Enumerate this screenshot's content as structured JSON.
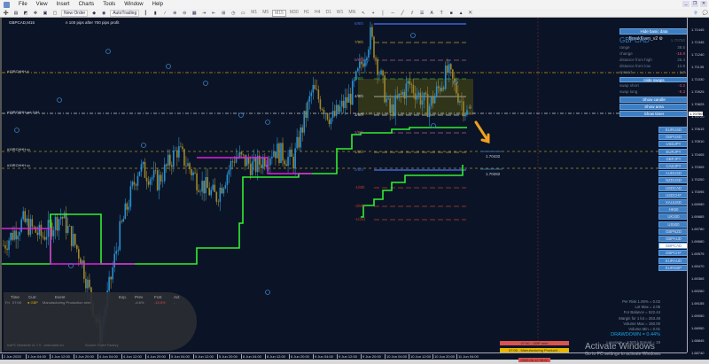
{
  "menu": [
    "File",
    "View",
    "Insert",
    "Charts",
    "Tools",
    "Window",
    "Help"
  ],
  "toolbar": {
    "new_order": "New Order",
    "autotrading": "AutoTrading",
    "timeframes": [
      "M1",
      "M5",
      "M15",
      "M30",
      "H1",
      "H4",
      "D1",
      "W1",
      "MN"
    ]
  },
  "chart": {
    "title": "GBPCAD,M15",
    "note": "n 100 pips after 700 pips profit",
    "ea_name": "BreakEven_v2",
    "levels": [
      {
        "label": "#15RCHHH d",
        "color": "#d58f1a"
      },
      {
        "label": "#15RCHHH wd 2:04",
        "color": "#c8c8d0"
      },
      {
        "label": "#15RCHHH rp",
        "color": "#b08a2a"
      },
      {
        "label": "#15RCHHH rp",
        "color": "#b08a2a"
      }
    ],
    "fib": [
      {
        "label": "8/8th",
        "color": "#3b64d8"
      },
      {
        "label": "7/8th",
        "color": "#b89a3a"
      },
      {
        "label": "6/8th",
        "color": "#b05a8a"
      },
      {
        "label": "5/8th",
        "color": "#3ea33e"
      },
      {
        "label": "4/8th",
        "color": "#c8c8c8"
      },
      {
        "label": "3/8th",
        "color": "#c8c8c8"
      },
      {
        "label": "2/8th",
        "color": "#b05a8a"
      },
      {
        "label": "1/8th",
        "color": "#b89a3a"
      },
      {
        "label": "0/8th",
        "color": "#3b64d8"
      },
      {
        "label": "-1/8th",
        "color": "#c0392b"
      },
      {
        "label": "-2/8th",
        "color": "#c0392b"
      },
      {
        "label": "-1/3rd",
        "color": "#c0392b"
      }
    ],
    "target1": "1.70432",
    "target2": "1.70282",
    "pip_label": "0.32"
  },
  "panel": {
    "hide_basic": "Hide basic data",
    "symbol": "GBPCAD",
    "price": "1.70750",
    "rows": [
      {
        "label": "range",
        "value": "38.5",
        "color": "#6b7f93"
      },
      {
        "label": "change",
        "value": "-15.9",
        "color": "#e05070"
      },
      {
        "label": "distance from high",
        "value": "25.4",
        "color": "#6b7f93"
      },
      {
        "label": "distance from low",
        "value": "12.8",
        "color": "#6b7f93"
      },
      {
        "label": "spread",
        "value": "1.9",
        "color": "#6b7f93"
      }
    ],
    "hide_swaps": "Hide swaps",
    "swaps": [
      {
        "label": "swap short",
        "value": "-3.2"
      },
      {
        "label": "swap long",
        "value": "-9.3"
      }
    ],
    "show_candle": "Show candle",
    "show_area": "Show area",
    "show_timer": "Show timer"
  },
  "symbols": [
    "EURUSD",
    "GBPUSD",
    "USDJPY",
    "EURJPY",
    "GBPJPY",
    "CADJPY",
    "AUDUSD",
    "NZDUSD",
    "USDCAD",
    "USDCHF",
    "XAUUSD",
    "HK50",
    "UK100",
    "US500",
    "GBPNZD",
    "GBPAUD",
    "GBPCAD",
    "GBPCHF",
    "EURAUD",
    "EURGBP"
  ],
  "selected_symbol": "GBPCAD",
  "stats": [
    "Per Risk 1.00% = 0.02",
    "Lot Max = 2.05",
    "For Balance = 522.44",
    "Margin for 1 lot = 253.48",
    "Volume Max = 150.00",
    "Volume Min = 0.01"
  ],
  "drawdown": "DRAWDOWN = 0.44%",
  "leverage": "Leverage = 1:500 | Spread = 19",
  "news": {
    "headers": [
      "Time",
      "Curr.",
      "Event",
      "Exp.",
      "Prev",
      "Fcst",
      "Act"
    ],
    "row": [
      "Fri",
      "07:00",
      "GBP",
      "Manufacturing Production m/m",
      "",
      "-4.6%",
      "-15.5%",
      "-"
    ],
    "footer_left": "IsaFX NewsInfo v1.7.0  -  www.isafx.eu",
    "footer_right": "Source: Forex Factory"
  },
  "events": {
    "e1": "07:00 - GBP m/m",
    "e2": "07:00 - Manufacturing Producti...",
    "date": "2020.06.12 08:00"
  },
  "price_axis": [
    "1.71445",
    "1.71345",
    "1.71240",
    "1.71135",
    "1.71030",
    "1.70925",
    "1.70825",
    "1.70720",
    "1.70615",
    "1.70510",
    "1.70405",
    "1.70305",
    "1.70200",
    "1.70095",
    "1.69990",
    "1.69885",
    "1.69780",
    "1.69680",
    "1.69575",
    "1.69470",
    "1.69365",
    "1.69260",
    "1.69155",
    "1.69050",
    "1.68950",
    "1.68845",
    "1.68740"
  ],
  "time_axis": [
    "2 Jun 2020",
    "3 Jun 04:00",
    "3 Jun 12:00",
    "3 Jun 20:00",
    "4 Jun 04:00",
    "4 Jun 12:00",
    "4 Jun 20:00",
    "5 Jun 04:00",
    "5 Jun 12:00",
    "5 Jun 20:00",
    "8 Jun 04:00",
    "8 Jun 12:00",
    "8 Jun 20:00",
    "9 Jun 04:00",
    "9 Jun 12:00",
    "9 Jun 20:00",
    "10 Jun 04:00",
    "10 Jun 12:00",
    "10 Jun 20:00",
    "11 Jun 04:00"
  ],
  "watermark": {
    "title": "Activate Windows",
    "sub": "Go to PC settings to activate Windows."
  },
  "price_anchors": [
    1.6965,
    1.6985,
    1.6972,
    1.699,
    1.6955,
    1.689,
    1.6975,
    1.703,
    1.7018,
    1.7045,
    1.702,
    1.7005,
    1.704,
    1.703,
    1.7045,
    1.7035,
    1.7095,
    1.707,
    1.709,
    1.714,
    1.7075,
    1.71,
    1.708,
    1.711,
    1.7075
  ]
}
